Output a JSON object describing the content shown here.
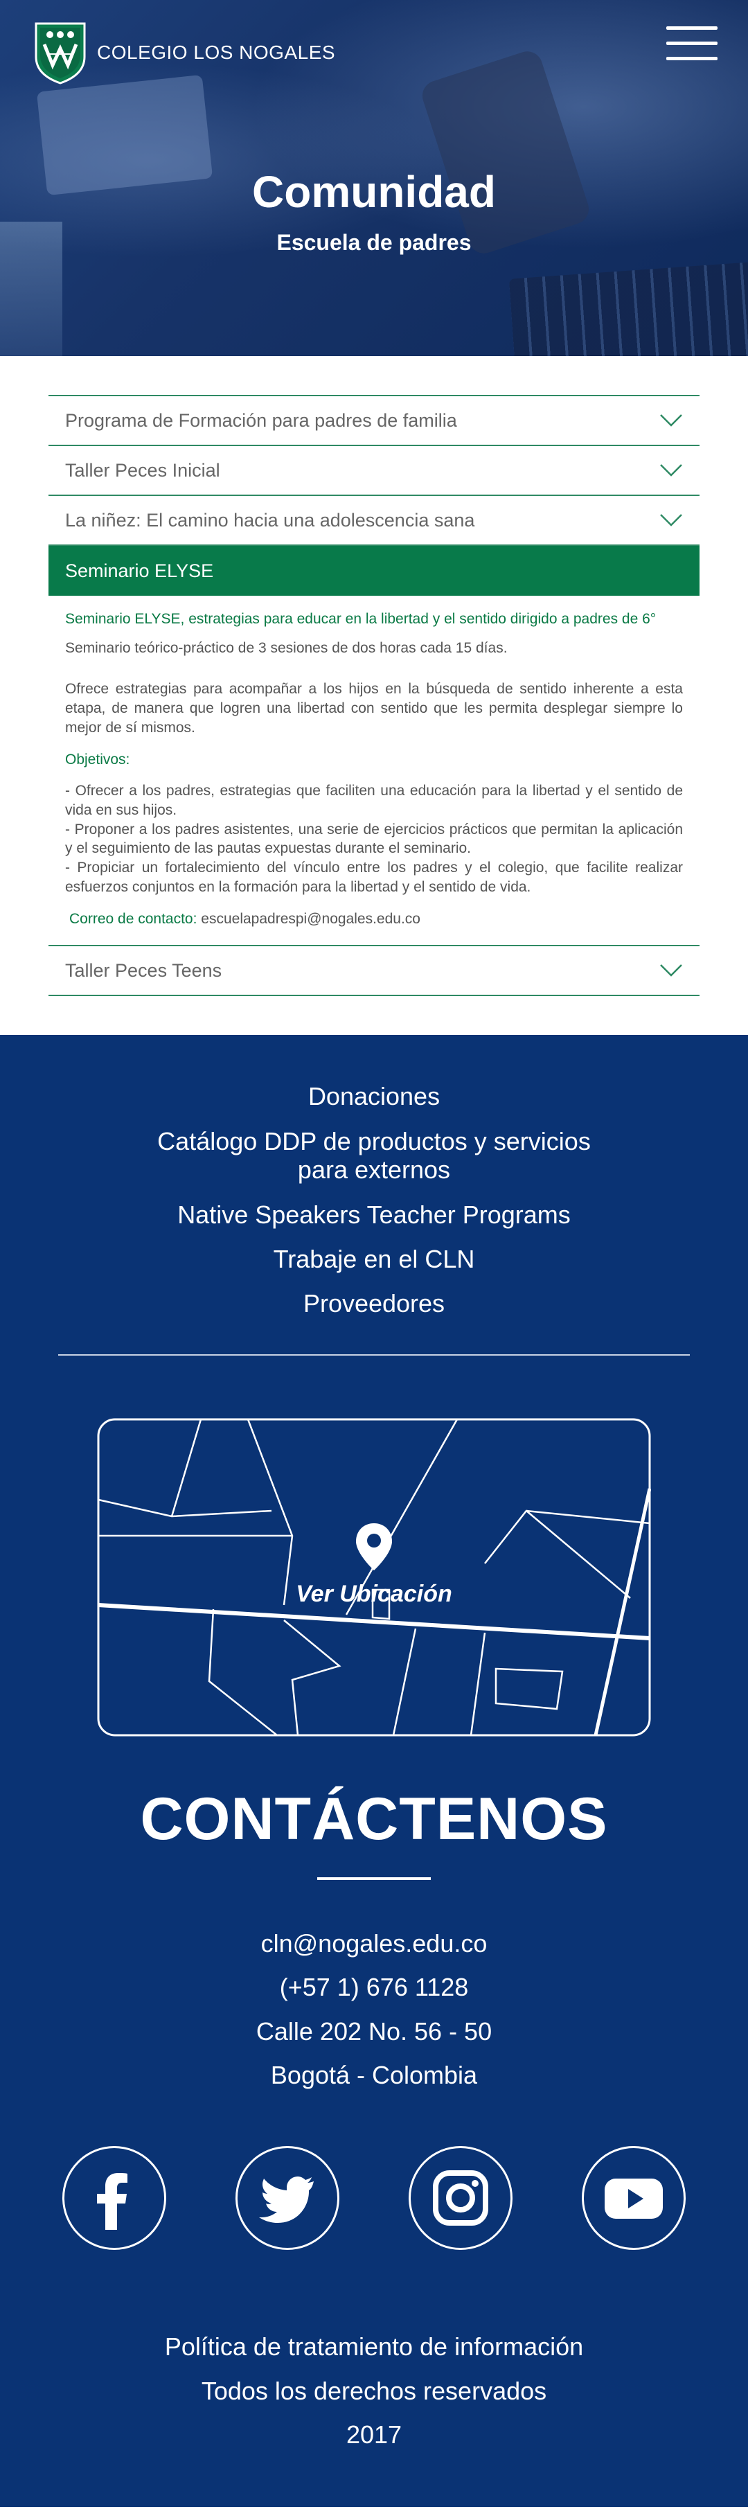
{
  "header": {
    "brand_name": "COLEGIO LOS NOGALES",
    "logo_icon": "shield-logo-icon",
    "menu_icon": "hamburger-menu-icon",
    "title": "Comunidad",
    "subtitle": "Escuela de padres"
  },
  "accordion": {
    "items": [
      {
        "label": "Programa de Formación para padres de familia",
        "icon": "chevron-down-icon"
      },
      {
        "label": "Taller Peces Inicial",
        "icon": "chevron-down-icon"
      },
      {
        "label": "La niñez: El camino hacia una adolescencia sana",
        "icon": "chevron-down-icon"
      },
      {
        "label": "Seminario ELYSE"
      },
      {
        "label": "Taller Peces Teens",
        "icon": "chevron-down-icon"
      }
    ],
    "open": {
      "heading": "Seminario ELYSE, estrategias para educar en la libertad y el sentido dirigido a padres de 6°",
      "sessions": "Seminario teórico-práctico de 3 sesiones de dos horas cada 15 días.",
      "description": "Ofrece estrategias para acompañar a los hijos en la búsqueda de sentido inherente a esta etapa, de manera que logren una libertad con sentido que les permita desplegar siempre lo mejor de sí mismos.",
      "objectives_title": "Objetivos:",
      "objectives": [
        "- Ofrecer a los padres, estrategias que faciliten una educación para la libertad y el sentido de vida en sus hijos.",
        "- Proponer a los padres asistentes, una serie de ejercicios prácticos que permitan la aplicación y el seguimiento de las pautas expuestas durante el seminario.",
        "- Propiciar un fortalecimiento del vínculo entre los padres y el colegio, que facilite realizar esfuerzos conjuntos en la formación para la libertad y el sentido de vida."
      ],
      "contact_label": "Correo de contacto:",
      "contact_email": "escuelapadrespi@nogales.edu.co"
    }
  },
  "footer": {
    "links": [
      "Donaciones",
      "Catálogo DDP de productos y servicios",
      "para externos",
      "Native Speakers Teacher Programs",
      "Trabaje en el CLN",
      "Proveedores"
    ],
    "map_label": "Ver Ubicación",
    "map_icon": "location-pin-icon",
    "contact_title": "CONTÁCTENOS",
    "contact": {
      "email": "cln@nogales.edu.co",
      "phone": "(+57 1) 676 1128",
      "address": "Calle 202 No. 56 - 50",
      "city": "Bogotá - Colombia"
    },
    "socials": [
      "facebook-icon",
      "twitter-icon",
      "instagram-icon",
      "youtube-icon"
    ],
    "legal": {
      "policy": "Política de tratamiento de información",
      "rights": "Todos los derechos reservados",
      "year": "2017"
    }
  },
  "colors": {
    "accent_green": "#087a4a",
    "footer_blue": "#0a3374",
    "hero_blue": "#173368"
  }
}
